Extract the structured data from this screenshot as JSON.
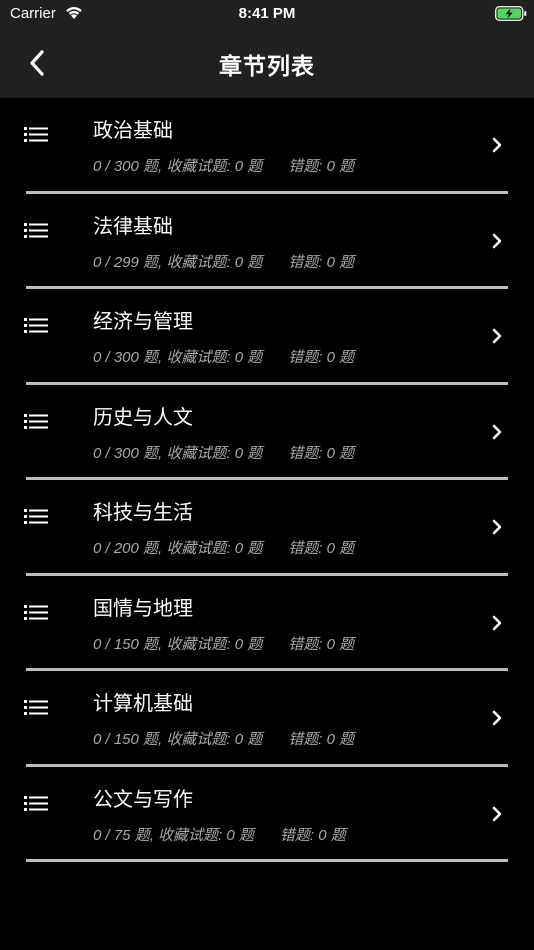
{
  "status_bar": {
    "carrier": "Carrier",
    "time": "8:41 PM"
  },
  "nav": {
    "title": "章节列表",
    "back_icon": "chevron-left-icon"
  },
  "colors": {
    "background": "#000000",
    "bar_background": "#202020",
    "divider": "#bdbdbd",
    "stats_text": "#a9a9a9",
    "battery_green": "#4cd964"
  },
  "chapters": [
    {
      "title": "政治基础",
      "progress": "0 / 300 题,",
      "favorites": "收藏试题: 0 题",
      "mistakes": "错题: 0 题"
    },
    {
      "title": "法律基础",
      "progress": "0 / 299 题,",
      "favorites": "收藏试题: 0 题",
      "mistakes": "错题: 0 题"
    },
    {
      "title": "经济与管理",
      "progress": "0 / 300 题,",
      "favorites": "收藏试题: 0 题",
      "mistakes": "错题: 0 题"
    },
    {
      "title": "历史与人文",
      "progress": "0 / 300 题,",
      "favorites": "收藏试题: 0 题",
      "mistakes": "错题: 0 题"
    },
    {
      "title": "科技与生活",
      "progress": "0 / 200 题,",
      "favorites": "收藏试题: 0 题",
      "mistakes": "错题: 0 题"
    },
    {
      "title": "国情与地理",
      "progress": "0 / 150 题,",
      "favorites": "收藏试题: 0 题",
      "mistakes": "错题: 0 题"
    },
    {
      "title": "计算机基础",
      "progress": "0 / 150 题,",
      "favorites": "收藏试题: 0 题",
      "mistakes": "错题: 0 题"
    },
    {
      "title": "公文与写作",
      "progress": "0 / 75 题,",
      "favorites": "收藏试题: 0 题",
      "mistakes": "错题: 0 题"
    }
  ]
}
